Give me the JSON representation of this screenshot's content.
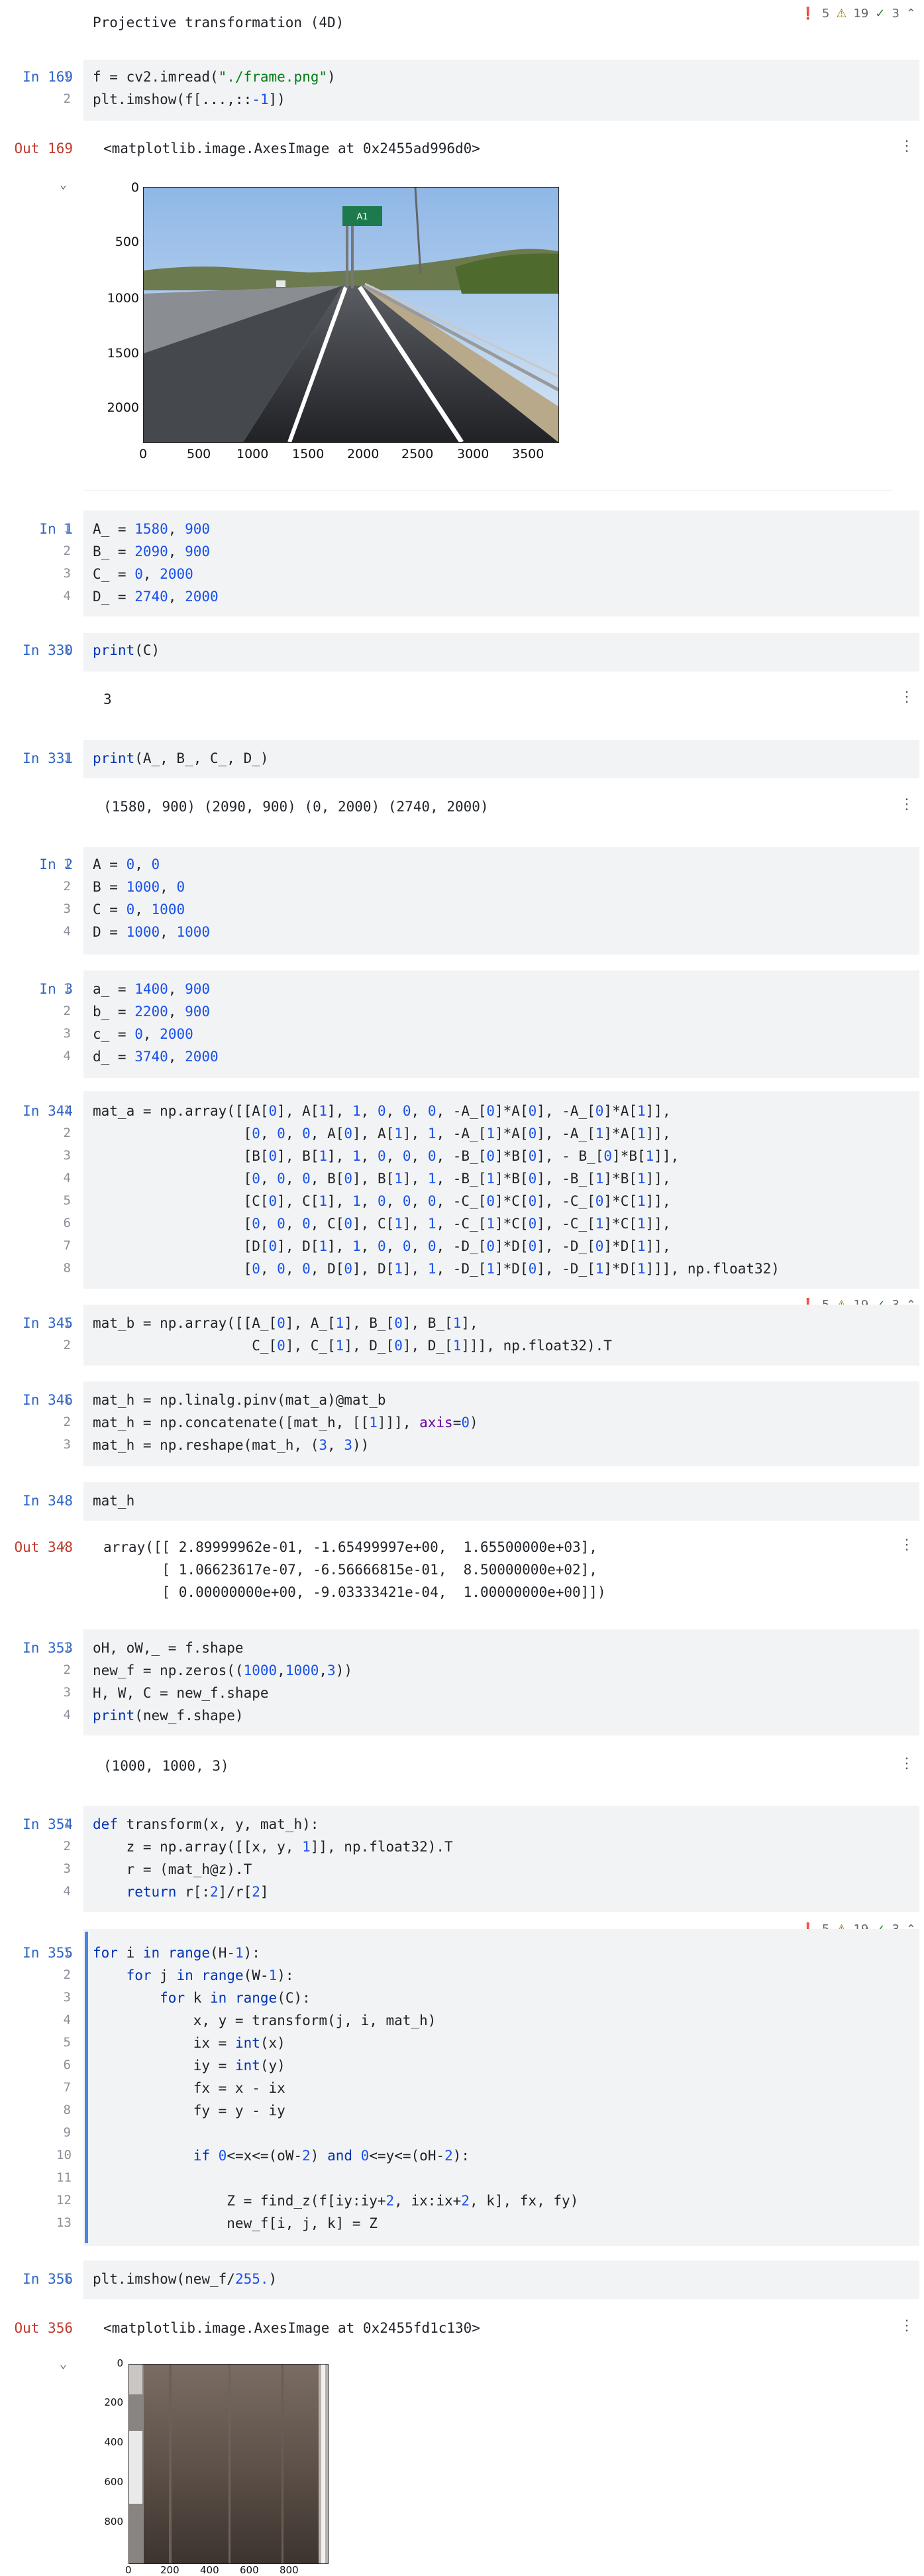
{
  "header": {
    "title": "Projective transformation (4D)",
    "status": {
      "errors": "5",
      "warnings": "19",
      "ok": "3"
    }
  },
  "cells": {
    "c169": {
      "label": "In 169",
      "lines": [
        "f = cv2.imread(\"./frame.png\")",
        "plt.imshow(f[...,::-1])"
      ]
    },
    "o169": {
      "label": "Out 169",
      "text": "<matplotlib.image.AxesImage at 0x2455ad996d0>",
      "plot": {
        "xticks": [
          "0",
          "500",
          "1000",
          "1500",
          "2000",
          "2500",
          "3000",
          "3500"
        ],
        "yticks": [
          "0",
          "500",
          "1000",
          "1500",
          "2000"
        ],
        "sign_text": "A1"
      }
    },
    "c1": {
      "label": "In 1",
      "lines": [
        "A_ = 1580, 900",
        "B_ = 2090, 900",
        "C_ = 0, 2000",
        "D_ = 2740, 2000"
      ]
    },
    "c330": {
      "label": "In 330",
      "lines": [
        "print(C)"
      ],
      "output": "3"
    },
    "c331": {
      "label": "In 331",
      "lines": [
        "print(A_, B_, C_, D_)"
      ],
      "output": "(1580, 900) (2090, 900) (0, 2000) (2740, 2000)"
    },
    "c2": {
      "label": "In 2",
      "lines": [
        "A = 0, 0",
        "B = 1000, 0",
        "C = 0, 1000",
        "D = 1000, 1000"
      ]
    },
    "c3": {
      "label": "In 3",
      "lines": [
        "a_ = 1400, 900",
        "b_ = 2200, 900",
        "c_ = 0, 2000",
        "d_ = 3740, 2000"
      ]
    },
    "c344": {
      "label": "In 344",
      "lines": [
        "mat_a = np.array([[A[0], A[1], 1, 0, 0, 0, -A_[0]*A[0], -A_[0]*A[1]],",
        "                  [0, 0, 0, A[0], A[1], 1, -A_[1]*A[0], -A_[1]*A[1]],",
        "                  [B[0], B[1], 1, 0, 0, 0, -B_[0]*B[0], - B_[0]*B[1]],",
        "                  [0, 0, 0, B[0], B[1], 1, -B_[1]*B[0], -B_[1]*B[1]],",
        "                  [C[0], C[1], 1, 0, 0, 0, -C_[0]*C[0], -C_[0]*C[1]],",
        "                  [0, 0, 0, C[0], C[1], 1, -C_[1]*C[0], -C_[1]*C[1]],",
        "                  [D[0], D[1], 1, 0, 0, 0, -D_[0]*D[0], -D_[0]*D[1]],",
        "                  [0, 0, 0, D[0], D[1], 1, -D_[1]*D[0], -D_[1]*D[1]]], np.float32)"
      ]
    },
    "c345": {
      "label": "In 345",
      "lines": [
        "mat_b = np.array([[A_[0], A_[1], B_[0], B_[1],",
        "                   C_[0], C_[1], D_[0], D_[1]]], np.float32).T"
      ]
    },
    "c346": {
      "label": "In 346",
      "lines": [
        "mat_h = np.linalg.pinv(mat_a)@mat_b",
        "mat_h = np.concatenate([mat_h, [[1]]], axis=0)",
        "mat_h = np.reshape(mat_h, (3, 3))"
      ]
    },
    "c348": {
      "label": "In 348",
      "lines": [
        "mat_h"
      ]
    },
    "o348": {
      "label": "Out 348",
      "lines": [
        "array([[ 2.89999962e-01, -1.65499997e+00,  1.65500000e+03],",
        "       [ 1.06623617e-07, -6.56666815e-01,  8.50000000e+02],",
        "       [ 0.00000000e+00, -9.03333421e-04,  1.00000000e+00]])"
      ]
    },
    "c353": {
      "label": "In 353",
      "lines": [
        "oH, oW,_ = f.shape",
        "new_f = np.zeros((1000,1000,3))",
        "H, W, C = new_f.shape",
        "print(new_f.shape)"
      ],
      "output": "(1000, 1000, 3)"
    },
    "c354": {
      "label": "In 354",
      "lines": [
        "def transform(x, y, mat_h):",
        "    z = np.array([[x, y, 1]], np.float32).T",
        "    r = (mat_h@z).T",
        "    return r[:2]/r[2]"
      ]
    },
    "c355": {
      "label": "In 355",
      "lines": [
        "for i in range(H-1):",
        "    for j in range(W-1):",
        "        for k in range(C):",
        "            x, y = transform(j, i, mat_h)",
        "            ix = int(x)",
        "            iy = int(y)",
        "            fx = x - ix",
        "            fy = y - iy",
        "",
        "            if 0<=x<=(oW-2) and 0<=y<=(oH-2):",
        "",
        "                Z = find_z(f[iy:iy+2, ix:ix+2, k], fx, fy)",
        "                new_f[i, j, k] = Z"
      ]
    },
    "c356": {
      "label": "In 356",
      "lines": [
        "plt.imshow(new_f/255.)"
      ]
    },
    "o356": {
      "label": "Out 356",
      "text": "<matplotlib.image.AxesImage at 0x2455fd1c130>",
      "plot": {
        "xticks": [
          "0",
          "200",
          "400",
          "600",
          "800"
        ],
        "yticks": [
          "0",
          "200",
          "400",
          "600",
          "800"
        ]
      }
    }
  },
  "colors": {
    "accent": "#2d63c7",
    "out": "#c0392b",
    "cell_bg": "#f2f3f5",
    "error": "#d32f2f",
    "warning": "#a07c00",
    "ok": "#2e7d32"
  }
}
